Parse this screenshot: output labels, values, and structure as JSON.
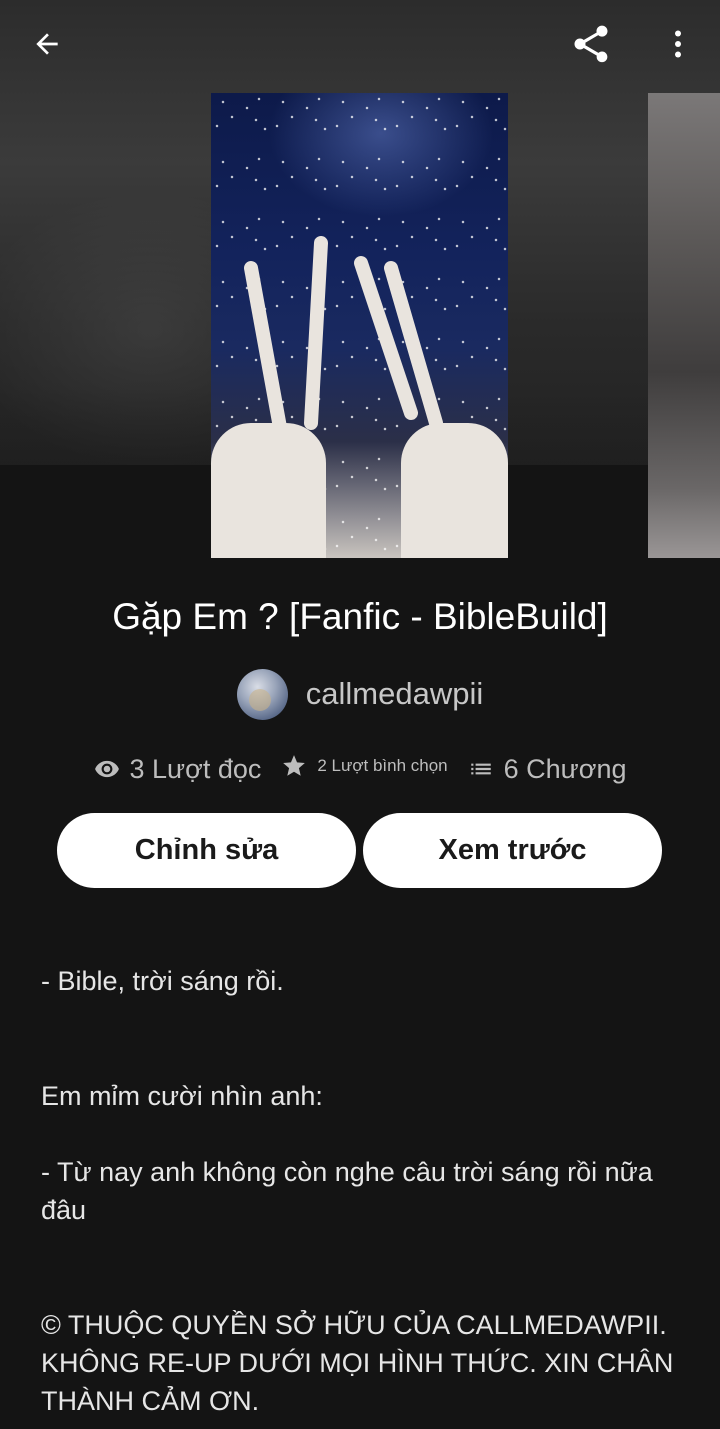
{
  "topbar": {
    "back_icon": "arrow-left-icon",
    "share_icon": "share-icon",
    "more_icon": "more-vertical-icon"
  },
  "story": {
    "title": "Gặp Em ? [Fanfic - BibleBuild]",
    "author": "callmedawpii"
  },
  "stats": {
    "reads": "3 Lượt đọc",
    "votes": "2 Lượt bình chọn",
    "chapters": "6 Chương"
  },
  "actions": {
    "edit_label": "Chỉnh sửa",
    "preview_label": "Xem trước"
  },
  "description": {
    "line1": "- Bible, trời sáng rồi.",
    "line2": "Em mỉm cười nhìn anh:",
    "line3": "- Từ nay anh không còn nghe câu trời sáng rồi nữa đâu",
    "line4": "© THUỘC QUYỀN SỞ HỮU CỦA CALLMEDAWPII. KHÔNG RE-UP DƯỚI MỌI HÌNH THỨC. XIN CHÂN THÀNH CẢM ƠN."
  },
  "colors": {
    "background": "#141414",
    "button_bg": "#ffffff",
    "muted_text": "#bdbdbd"
  }
}
